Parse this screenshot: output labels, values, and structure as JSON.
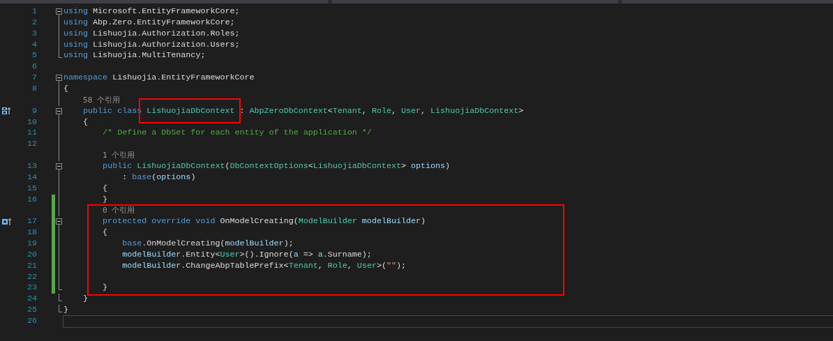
{
  "editor": {
    "rows": [
      {
        "kind": "code",
        "number": "1",
        "expanded": true,
        "changed": false,
        "current": false,
        "tokens": [
          {
            "kind": "keyword",
            "text": "using"
          },
          {
            "kind": "plain",
            "text": " Microsoft.EntityFrameworkCore;"
          }
        ]
      },
      {
        "kind": "code",
        "number": "2",
        "changed": false,
        "current": false,
        "tokens": [
          {
            "kind": "keyword",
            "text": "using"
          },
          {
            "kind": "plain",
            "text": " Abp.Zero.EntityFrameworkCore;"
          }
        ]
      },
      {
        "kind": "code",
        "number": "3",
        "changed": false,
        "current": false,
        "tokens": [
          {
            "kind": "keyword",
            "text": "using"
          },
          {
            "kind": "plain",
            "text": " Lishuojia.Authorization.Roles;"
          }
        ]
      },
      {
        "kind": "code",
        "number": "4",
        "changed": false,
        "current": false,
        "tokens": [
          {
            "kind": "keyword",
            "text": "using"
          },
          {
            "kind": "plain",
            "text": " Lishuojia.Authorization.Users;"
          }
        ]
      },
      {
        "kind": "code",
        "number": "5",
        "block_end": true,
        "changed": false,
        "current": false,
        "tokens": [
          {
            "kind": "keyword",
            "text": "using"
          },
          {
            "kind": "plain",
            "text": " Lishuojia.MultiTenancy;"
          }
        ]
      },
      {
        "kind": "code",
        "number": "6",
        "changed": false,
        "current": false,
        "tokens": []
      },
      {
        "kind": "code",
        "number": "7",
        "expanded": true,
        "changed": false,
        "current": false,
        "tokens": [
          {
            "kind": "keyword",
            "text": "namespace"
          },
          {
            "kind": "plain",
            "text": " Lishuojia.EntityFrameworkCore"
          }
        ]
      },
      {
        "kind": "code",
        "number": "8",
        "changed": false,
        "current": false,
        "tokens": [
          {
            "kind": "plain",
            "text": "{"
          }
        ]
      },
      {
        "kind": "lens",
        "text": "58 个引用",
        "changed": false
      },
      {
        "kind": "code",
        "number": "9",
        "expanded": true,
        "implements_interface": true,
        "changed": false,
        "current": false,
        "tokens": [
          {
            "kind": "keyword",
            "text": "    public class "
          },
          {
            "kind": "type",
            "text": "LishuojiaDbContext"
          },
          {
            "kind": "plain",
            "text": " : "
          },
          {
            "kind": "type",
            "text": "AbpZeroDbContext"
          },
          {
            "kind": "plain",
            "text": "<"
          },
          {
            "kind": "type",
            "text": "Tenant"
          },
          {
            "kind": "plain",
            "text": ", "
          },
          {
            "kind": "type",
            "text": "Role"
          },
          {
            "kind": "plain",
            "text": ", "
          },
          {
            "kind": "type",
            "text": "User"
          },
          {
            "kind": "plain",
            "text": ", "
          },
          {
            "kind": "type",
            "text": "LishuojiaDbContext"
          },
          {
            "kind": "plain",
            "text": ">"
          }
        ]
      },
      {
        "kind": "code",
        "number": "10",
        "changed": false,
        "current": false,
        "tokens": [
          {
            "kind": "plain",
            "text": "    {"
          }
        ]
      },
      {
        "kind": "code",
        "number": "11",
        "changed": false,
        "current": false,
        "tokens": [
          {
            "kind": "comment",
            "text": "        /* Define a DbSet for each entity of the application */"
          }
        ]
      },
      {
        "kind": "code",
        "number": "12",
        "changed": false,
        "current": false,
        "tokens": []
      },
      {
        "kind": "lens",
        "text": "1 个引用",
        "changed": false
      },
      {
        "kind": "code",
        "number": "13",
        "expanded": true,
        "changed": false,
        "current": false,
        "tokens": [
          {
            "kind": "keyword",
            "text": "        public "
          },
          {
            "kind": "type",
            "text": "LishuojiaDbContext"
          },
          {
            "kind": "plain",
            "text": "("
          },
          {
            "kind": "type",
            "text": "DbContextOptions"
          },
          {
            "kind": "plain",
            "text": "<"
          },
          {
            "kind": "type",
            "text": "LishuojiaDbContext"
          },
          {
            "kind": "plain",
            "text": "> "
          },
          {
            "kind": "param",
            "text": "options"
          },
          {
            "kind": "plain",
            "text": ")"
          }
        ]
      },
      {
        "kind": "code",
        "number": "14",
        "changed": false,
        "current": false,
        "tokens": [
          {
            "kind": "plain",
            "text": "            : "
          },
          {
            "kind": "keyword",
            "text": "base"
          },
          {
            "kind": "plain",
            "text": "("
          },
          {
            "kind": "param",
            "text": "options"
          },
          {
            "kind": "plain",
            "text": ")"
          }
        ]
      },
      {
        "kind": "code",
        "number": "15",
        "changed": false,
        "current": false,
        "tokens": [
          {
            "kind": "plain",
            "text": "        {"
          }
        ]
      },
      {
        "kind": "code",
        "number": "16",
        "changed": true,
        "current": false,
        "tokens": [
          {
            "kind": "plain",
            "text": "        }"
          }
        ]
      },
      {
        "kind": "lens",
        "text": "0 个引用",
        "changed": true
      },
      {
        "kind": "code",
        "number": "17",
        "expanded": true,
        "overrides_member": true,
        "changed": true,
        "current": false,
        "tokens": [
          {
            "kind": "keyword",
            "text": "        protected override void"
          },
          {
            "kind": "plain",
            "text": " OnModelCreating("
          },
          {
            "kind": "type",
            "text": "ModelBuilder"
          },
          {
            "kind": "param",
            "text": " modelBuilder"
          },
          {
            "kind": "plain",
            "text": ")"
          }
        ]
      },
      {
        "kind": "code",
        "number": "18",
        "changed": true,
        "current": false,
        "tokens": [
          {
            "kind": "plain",
            "text": "        {"
          }
        ]
      },
      {
        "kind": "code",
        "number": "19",
        "changed": true,
        "current": false,
        "tokens": [
          {
            "kind": "keyword",
            "text": "            base"
          },
          {
            "kind": "plain",
            "text": ".OnModelCreating("
          },
          {
            "kind": "param",
            "text": "modelBuilder"
          },
          {
            "kind": "plain",
            "text": ");"
          }
        ]
      },
      {
        "kind": "code",
        "number": "20",
        "changed": true,
        "current": false,
        "tokens": [
          {
            "kind": "param",
            "text": "            modelBuilder"
          },
          {
            "kind": "plain",
            "text": ".Entity<"
          },
          {
            "kind": "type",
            "text": "User"
          },
          {
            "kind": "plain",
            "text": ">().Ignore("
          },
          {
            "kind": "param",
            "text": "a"
          },
          {
            "kind": "plain",
            "text": " => "
          },
          {
            "kind": "param",
            "text": "a"
          },
          {
            "kind": "plain",
            "text": ".Surname);"
          }
        ]
      },
      {
        "kind": "code",
        "number": "21",
        "changed": true,
        "current": false,
        "tokens": [
          {
            "kind": "param",
            "text": "            modelBuilder"
          },
          {
            "kind": "plain",
            "text": ".ChangeAbpTablePrefix<"
          },
          {
            "kind": "type",
            "text": "Tenant"
          },
          {
            "kind": "plain",
            "text": ", "
          },
          {
            "kind": "type",
            "text": "Role"
          },
          {
            "kind": "plain",
            "text": ", "
          },
          {
            "kind": "type",
            "text": "User"
          },
          {
            "kind": "plain",
            "text": ">("
          },
          {
            "kind": "string",
            "text": "\"\""
          },
          {
            "kind": "plain",
            "text": ");"
          }
        ]
      },
      {
        "kind": "code",
        "number": "22",
        "changed": true,
        "current": false,
        "tokens": []
      },
      {
        "kind": "code",
        "number": "23",
        "block_end": true,
        "changed": true,
        "current": false,
        "tokens": [
          {
            "kind": "plain",
            "text": "        }"
          }
        ]
      },
      {
        "kind": "code",
        "number": "24",
        "block_end": true,
        "changed": false,
        "current": false,
        "tokens": [
          {
            "kind": "plain",
            "text": "    }"
          }
        ]
      },
      {
        "kind": "code",
        "number": "25",
        "block_end": true,
        "changed": false,
        "current": false,
        "tokens": [
          {
            "kind": "plain",
            "text": "}"
          }
        ]
      },
      {
        "kind": "code",
        "number": "26",
        "changed": false,
        "current": true,
        "tokens": []
      }
    ]
  }
}
